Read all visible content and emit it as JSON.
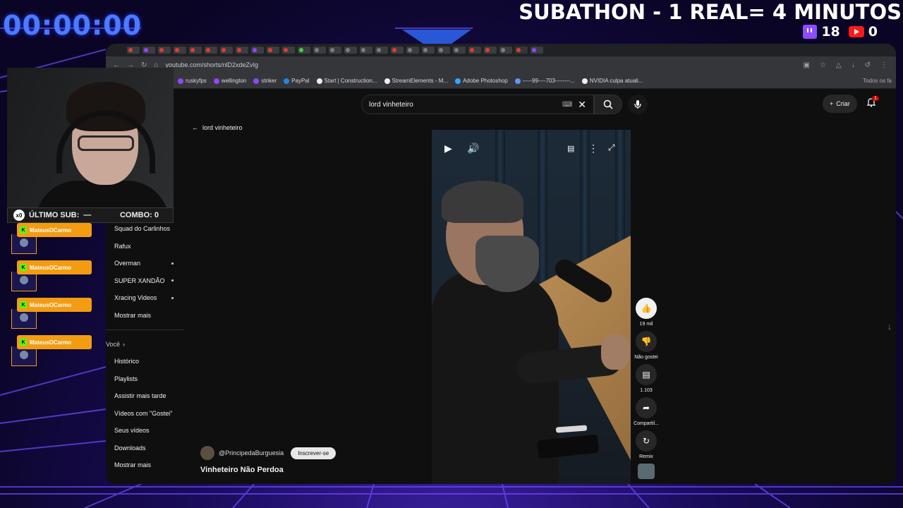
{
  "overlay": {
    "timer": "00:00:00",
    "subathon": "SUBATHON - 1 REAL= 4 MINUTOS",
    "twitch_count": "18",
    "youtube_count": "0",
    "combo_x": "x0",
    "last_sub_label": "ÚLTIMO SUB:",
    "last_sub_value": "—",
    "combo_label": "COMBO:",
    "combo_value": "0",
    "chat": [
      {
        "name": "MateusOCarmo"
      },
      {
        "name": "MateusOCarmo"
      },
      {
        "name": "MateusOCarmo"
      },
      {
        "name": "MateusOCarmo"
      }
    ]
  },
  "browser": {
    "url": "youtube.com/shorts/nlD2xdeZvIg",
    "bookmarks": [
      "ruskyfps",
      "wellington",
      "striker",
      "PayPal",
      "Start | Construction...",
      "StreamElements - M...",
      "Adobe Photoshop",
      "-----99----703--------...",
      "NVIDIA culpa atuali..."
    ],
    "all_bookmarks": "Todos os fa"
  },
  "youtube": {
    "search_value": "lord vinheteiro",
    "create_label": "Criar",
    "notif_count": "1",
    "back_label": "lord vinheteiro",
    "sidebar_subs": [
      "Squad do Carlinhos",
      "Rafux",
      "Overman",
      "SUPER XANDÃO",
      "Xracing Videos",
      "Mostrar mais"
    ],
    "sidebar_you_label": "Você",
    "sidebar_you": [
      "Histórico",
      "Playlists",
      "Assistir mais tarde",
      "Vídeos com \"Gostei\"",
      "Seus vídeos",
      "Downloads",
      "Mostrar mais"
    ],
    "creator_handle": "@PrincipedaBurguesia",
    "subscribe_label": "Inscrever-se",
    "short_title": "Vinheteiro Não Perdoa",
    "actions": {
      "like_count": "19 mil",
      "dislike_label": "Não gostei",
      "comments_count": "1.103",
      "share_label": "Compartil...",
      "remix_label": "Remix"
    }
  },
  "colors": {
    "timer": "#4b7bff",
    "chat_name_bg": "#f39c12",
    "kick_green": "#53fc18",
    "twitch_purple": "#8d4cff",
    "youtube_red": "#ff1a1a"
  }
}
